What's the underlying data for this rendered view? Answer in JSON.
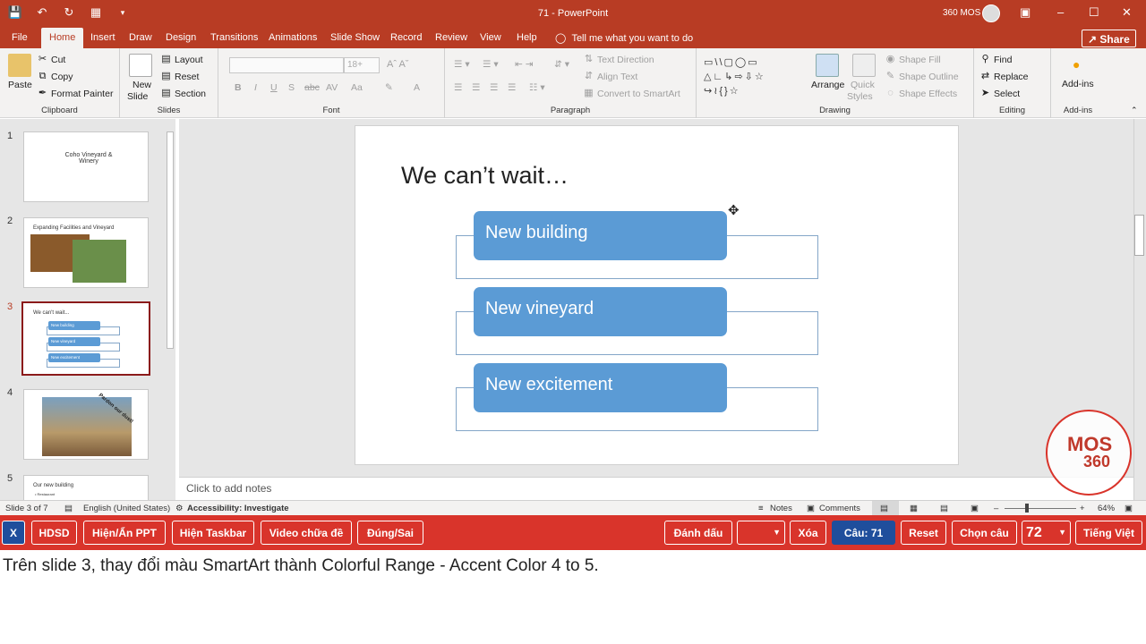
{
  "titlebar": {
    "title": "71  -  PowerPoint",
    "user": "360 MOS",
    "qat_icons": [
      "save-icon",
      "undo-icon",
      "redo-icon",
      "presenter-icon",
      "customize-icon"
    ]
  },
  "menu": {
    "tabs": [
      "File",
      "Home",
      "Insert",
      "Draw",
      "Design",
      "Transitions",
      "Animations",
      "Slide Show",
      "Record",
      "Review",
      "View",
      "Help"
    ],
    "active_tab": "Home",
    "tell_me": "Tell me what you want to do",
    "share": "Share"
  },
  "ribbon": {
    "clipboard": {
      "paste": "Paste",
      "cut": "Cut",
      "copy": "Copy",
      "format_painter": "Format Painter",
      "label": "Clipboard"
    },
    "slides": {
      "new_slide_1": "New",
      "new_slide_2": "Slide",
      "layout": "Layout",
      "reset": "Reset",
      "section": "Section",
      "label": "Slides"
    },
    "font": {
      "label": "Font",
      "size": "18+"
    },
    "paragraph": {
      "text_direction": "Text Direction",
      "align_text": "Align Text",
      "convert": "Convert to SmartArt",
      "label": "Paragraph"
    },
    "drawing": {
      "arrange": "Arrange",
      "quick_styles_1": "Quick",
      "quick_styles_2": "Styles",
      "shape_fill": "Shape Fill",
      "shape_outline": "Shape Outline",
      "shape_effects": "Shape Effects",
      "label": "Drawing"
    },
    "editing": {
      "find": "Find",
      "replace": "Replace",
      "select": "Select",
      "label": "Editing"
    },
    "addins": {
      "addins": "Add-ins",
      "label": "Add-ins"
    }
  },
  "thumbnails": [
    {
      "num": "1",
      "text": "Coho Vineyard & Winery"
    },
    {
      "num": "2",
      "text": "Expanding Facilities and Vineyard"
    },
    {
      "num": "3",
      "text": "We can't wait...",
      "items": [
        "New building",
        "New vineyard",
        "New excitement"
      ]
    },
    {
      "num": "4",
      "text": "Pardon our dust!"
    },
    {
      "num": "5",
      "text": "Our new building",
      "sub": "• Restaurant"
    }
  ],
  "slide": {
    "title": "We can’t wait…",
    "smartart": [
      "New building",
      "New vineyard",
      "New excitement"
    ],
    "accent": "#5b9bd5"
  },
  "notes_placeholder": "Click to add notes",
  "statusbar": {
    "slide_of": "Slide 3 of 7",
    "language": "English (United States)",
    "accessibility": "Accessibility: Investigate",
    "notes": "Notes",
    "comments": "Comments",
    "zoom": "64%"
  },
  "logo": {
    "line1": "MOS",
    "line2": "360"
  },
  "toolbar": {
    "x": "X",
    "hdsd": "HDSD",
    "toggle_ppt": "Hiện/Ẩn PPT",
    "taskbar": "Hiện Taskbar",
    "video": "Video chữa đề",
    "true_false": "Đúng/Sai",
    "mark": "Đánh dấu",
    "delete": "Xóa",
    "question": "Câu: 71",
    "reset": "Reset",
    "choose": "Chọn câu",
    "choose_value": "72",
    "language": "Tiếng Việt"
  },
  "question_text": "Trên slide 3, thay đổi màu SmartArt thành Colorful Range - Accent Color 4 to 5."
}
